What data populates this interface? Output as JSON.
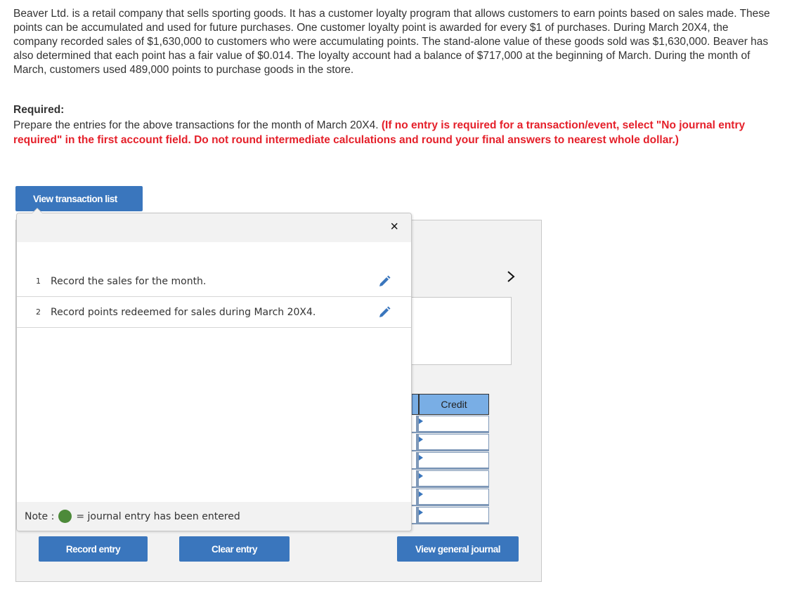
{
  "problem": {
    "text": "Beaver Ltd. is a retail company that sells sporting goods. It has a customer loyalty program that allows customers to earn points based on sales made. These points can be accumulated and used for future purchases. One customer loyalty point is awarded for every $1 of purchases. During March 20X4, the company recorded sales of $1,630,000 to customers who were accumulating points. The stand-alone value of these goods sold was $1,630,000. Beaver has also determined that each point has a fair value of $0.014. The loyalty account had a balance of $717,000 at the beginning of March. During the month of March, customers used 489,000 points to purchase goods in the store."
  },
  "required": {
    "title": "Required:",
    "instruction": "Prepare the entries for the above transactions for the month of March 20X4. ",
    "note_red": "(If no entry is required for a transaction/event, select \"No journal entry required\" in the first account field. Do not round intermediate calculations and round your final answers to nearest whole dollar.)"
  },
  "buttons": {
    "view_transaction_list": "View transaction list",
    "record_entry": "Record entry",
    "clear_entry": "Clear entry",
    "view_general_journal": "View general journal"
  },
  "popup": {
    "close_icon": "×",
    "transactions": [
      {
        "number": "1",
        "label": "Record the sales for the month."
      },
      {
        "number": "2",
        "label": "Record points redeemed for sales during March 20X4."
      }
    ],
    "note_prefix": "Note :",
    "note_suffix": "= journal entry has been entered"
  },
  "journal": {
    "next_icon": "›",
    "credit_header": "Credit",
    "row_count": 6
  },
  "colors": {
    "button_blue": "#3a76bd",
    "warning_red": "#e5202a",
    "entered_green": "#4d8a3a",
    "header_blue": "#79aee5"
  }
}
